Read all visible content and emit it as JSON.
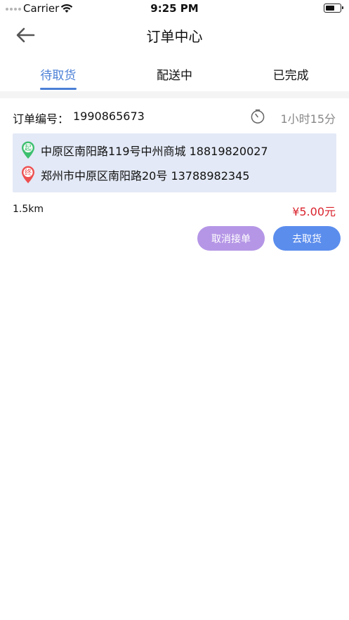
{
  "status_bar": {
    "carrier": "Carrier",
    "time": "9:25 PM"
  },
  "nav": {
    "title": "订单中心"
  },
  "tabs": [
    {
      "label": "待取货",
      "active": true
    },
    {
      "label": "配送中",
      "active": false
    },
    {
      "label": "已完成",
      "active": false
    }
  ],
  "order": {
    "number_label": "订单编号：",
    "number": "1990865673",
    "time_left": "1小时15分",
    "pickup": {
      "badge": "起",
      "address": "中原区南阳路119号中州商城 18819820027",
      "color": "#3cbf6e"
    },
    "dropoff": {
      "badge": "终",
      "address": "郑州市中原区南阳路20号 13788982345",
      "color": "#ee4f4f"
    },
    "distance": "1.5km",
    "price": "¥5.00元",
    "cancel_label": "取消接单",
    "pickup_label": "去取货"
  },
  "colors": {
    "accent": "#4a7fd6",
    "price": "#d9232d",
    "cancel_button": "#b596e6",
    "pickup_button": "#5b8ded",
    "address_bg": "#e3e9f6"
  }
}
